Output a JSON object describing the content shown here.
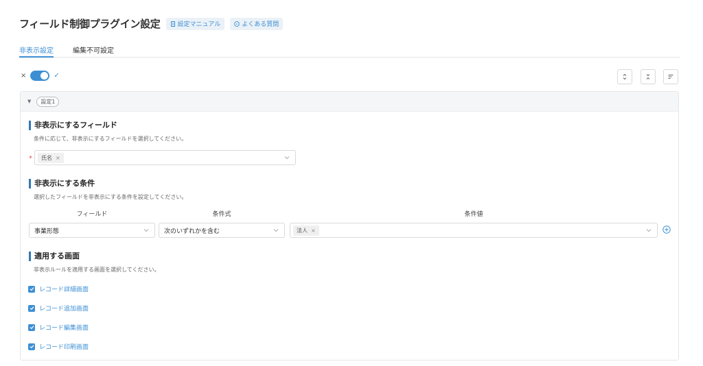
{
  "header": {
    "title": "フィールド制御プラグイン設定",
    "manual_label": "設定マニュアル",
    "faq_label": "よくある質問"
  },
  "tabs": [
    {
      "label": "非表示設定",
      "active": true
    },
    {
      "label": "編集不可設定",
      "active": false
    }
  ],
  "toggle": {
    "off_mark": "×",
    "on_mark": "✓",
    "enabled": true
  },
  "toolbar": {
    "icons": [
      "expand-all-icon",
      "collapse-all-icon",
      "sort-icon"
    ]
  },
  "panel": {
    "setting_tag": "設定1",
    "hide_fields": {
      "title": "非表示にするフィールド",
      "description": "条件に応じて、非表示にするフィールドを選択してください。",
      "required_mark": "*",
      "selected": [
        "氏名"
      ],
      "tag_remove": "×"
    },
    "conditions": {
      "title": "非表示にする条件",
      "description": "選択したフィールドを非表示にする条件を設定してください。",
      "headers": {
        "field": "フィールド",
        "expression": "条件式",
        "value": "条件値"
      },
      "rows": [
        {
          "field": "事業形態",
          "expression": "次のいずれかを含む",
          "values": [
            "法人"
          ]
        }
      ]
    },
    "screens": {
      "title": "適用する画面",
      "description": "非表示ルールを適用する画面を選択してください。",
      "items": [
        {
          "label": "レコード詳細画面",
          "checked": true
        },
        {
          "label": "レコード追加画面",
          "checked": true
        },
        {
          "label": "レコード編集画面",
          "checked": true
        },
        {
          "label": "レコード印刷画面",
          "checked": true
        }
      ]
    }
  },
  "colors": {
    "accent": "#3d8fd4",
    "section_bar": "#2f78b8",
    "required": "#e05050"
  }
}
